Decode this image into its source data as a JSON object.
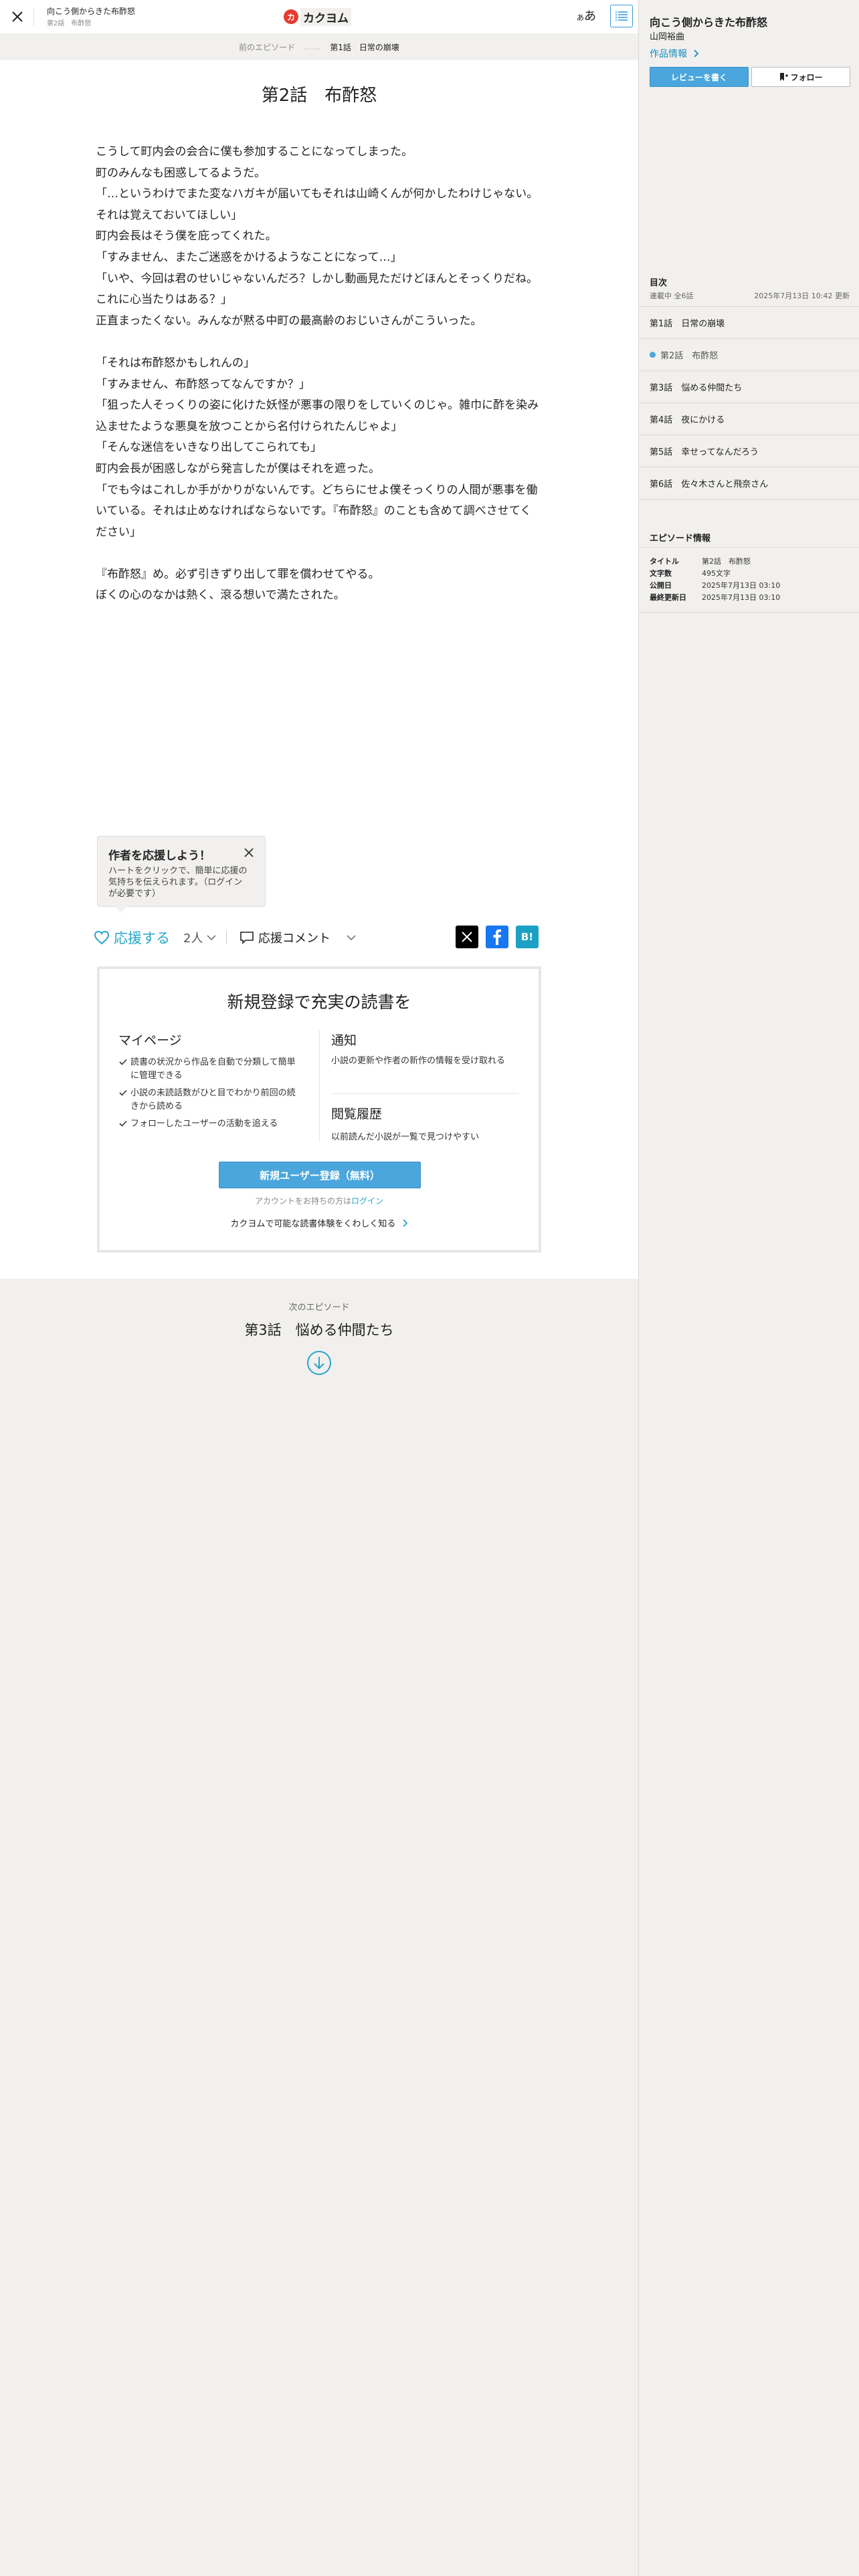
{
  "header": {
    "work_title": "向こう側からきた布酢怒",
    "episode_sub": "第2話　布酢怒",
    "logo_mark": "カ",
    "logo_text": "カクヨム",
    "font_button_small": "あ",
    "font_button_large": "あ"
  },
  "subbar": {
    "prev_label": "前のエピソード",
    "dots": "……",
    "prev_title": "第1話　日常の崩壊"
  },
  "episode": {
    "title": "第2話　布酢怒",
    "paragraphs": [
      "こうして町内会の会合に僕も参加することになってしまった。",
      "町のみんなも困惑してるようだ。",
      "「…というわけでまた変なハガキが届いてもそれは山崎くんが何かしたわけじゃない。それは覚えておいてほしい」",
      "町内会長はそう僕を庇ってくれた。",
      "「すみません、またご迷惑をかけるようなことになって…」",
      "「いや、今回は君のせいじゃないんだろ？しかし動画見ただけどほんとそっくりだね。これに心当たりはある？」",
      "正直まったくない。みんなが黙る中町の最高齢のおじいさんがこういった。",
      "",
      "「それは布酢怒かもしれんの」",
      "「すみません、布酢怒ってなんですか？」",
      "「狙った人そっくりの姿に化けた妖怪が悪事の限りをしていくのじゃ。雑巾に酢を染み込ませたような悪臭を放つことから名付けられたんじゃよ」",
      "「そんな迷信をいきなり出してこられても」",
      "町内会長が困惑しながら発言したが僕はそれを遮った。",
      "「でも今はこれしか手がかりがないんです。どちらにせよ僕そっくりの人間が悪事を働いている。それは止めなければならないです。『布酢怒』のことも含めて調べさせてください」",
      "",
      "『布酢怒』め。必ず引きずり出して罪を償わせてやる。",
      "ぼくの心のなかは熱く、滾る想いで満たされた。"
    ]
  },
  "tooltip": {
    "title": "作者を応援しよう！",
    "text": "ハートをクリックで、簡単に応援の気持ちを伝えられます。（ログインが必要です）"
  },
  "actions": {
    "support_label": "応援する",
    "support_count": "2人",
    "comment_label": "応援コメント",
    "share_hatena": "B!"
  },
  "signup": {
    "title": "新規登録で充実の読書を",
    "mypage_heading": "マイページ",
    "mypage_items": [
      "読書の状況から作品を自動で分類して簡単に管理できる",
      "小説の未読話数がひと目でわかり前回の続きから読める",
      "フォローしたユーザーの活動を追える"
    ],
    "notify_heading": "通知",
    "notify_text": "小説の更新や作者の新作の情報を受け取れる",
    "history_heading": "閲覧履歴",
    "history_text": "以前読んだ小説が一覧で見つけやすい",
    "register_button": "新規ユーザー登録（無料）",
    "login_prefix": "アカウントをお持ちの方は",
    "login_link": "ログイン",
    "more_link": "カクヨムで可能な読書体験をくわしく知る"
  },
  "next": {
    "label": "次のエピソード",
    "title": "第3話　悩める仲間たち"
  },
  "sidebar": {
    "work_title": "向こう側からきた布酢怒",
    "author": "山岡裕曲",
    "info_link": "作品情報",
    "review_button": "レビューを書く",
    "follow_button": "フォロー",
    "toc_heading": "目次",
    "status": "連載中 全6話",
    "updated": "2025年7月13日 10:42 更新",
    "episodes": [
      {
        "label": "第1話　日常の崩壊",
        "current": false
      },
      {
        "label": "第2話　布酢怒",
        "current": true
      },
      {
        "label": "第3話　悩める仲間たち",
        "current": false
      },
      {
        "label": "第4話　夜にかける",
        "current": false
      },
      {
        "label": "第5話　幸せってなんだろう",
        "current": false
      },
      {
        "label": "第6話　佐々木さんと飛奈さん",
        "current": false
      }
    ],
    "episode_info_heading": "エピソード情報",
    "episode_info": [
      {
        "key": "タイトル",
        "value": "第2話　布酢怒"
      },
      {
        "key": "文字数",
        "value": "495文字"
      },
      {
        "key": "公開日",
        "value": "2025年7月13日 03:10"
      },
      {
        "key": "最終更新日",
        "value": "2025年7月13日 03:10"
      }
    ]
  },
  "colors": {
    "accent": "#27a5c9",
    "button_blue": "#4aa6dc",
    "logo_red": "#e83a2d",
    "page_bg": "#f1f0ee"
  },
  "icons": [
    "close-icon",
    "toc-list-icon",
    "heart-icon",
    "chevron-down-icon",
    "comment-icon",
    "x-logo-icon",
    "facebook-icon",
    "check-icon",
    "chevron-right-icon",
    "arrow-down-circle-icon",
    "bookmark-plus-icon"
  ]
}
